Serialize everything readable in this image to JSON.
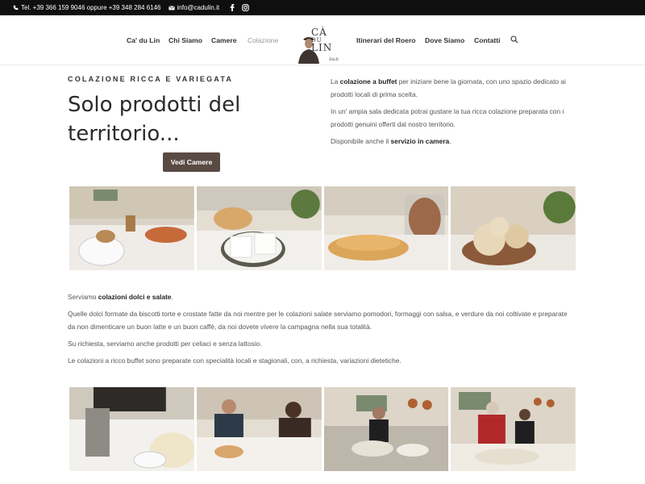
{
  "topbar": {
    "phone": "Tel. +39 366 159 9046 oppure +39 348 284 6146",
    "email": "info@cadulin.it",
    "icons": [
      "phone-icon",
      "mail-icon",
      "facebook-icon",
      "instagram-icon"
    ]
  },
  "nav": {
    "items": [
      "Ca' du Lin",
      "Chi Siamo",
      "Camere",
      "Colazione",
      "Itinerari del Roero",
      "Dove Siamo",
      "Contatti"
    ],
    "active": "Colazione"
  },
  "logo": {
    "line1": "CÀ",
    "line2": "DU",
    "line3": "LIN",
    "sub": "B&B"
  },
  "hero": {
    "eyebrow": "COLAZIONE RICCA E VARIEGATA",
    "title": "Solo prodotti del territorio...",
    "button": "Vedi Camere"
  },
  "intro": {
    "p1_pre": "La ",
    "p1_bold": "colazione a buffet",
    "p1_post": " per iniziare bene la giornata, con uno spazio dedicato ai prodotti locali di prima scelta.",
    "p2": "In un' ampia sala dedicata potrai gustare la tua ricca colazione preparata con i prodotti genuini offerti dal nostro territorio.",
    "p3_pre": "Disponibile anche il ",
    "p3_bold": "servizio in camera",
    "p3_post": "."
  },
  "body": {
    "p1_pre": "Serviamo ",
    "p1_bold": "colazioni dolci e salate",
    "p1_post": ".",
    "p2": "Quelle dolci formate da biscotti torte e crostate fatte da noi mentre per le colazioni salate serviamo pomodori, formaggi con salsa, e verdure da noi coltivate e preparate da non dimenticare un buon latte e un buon caffè, da noi dovete vivere la campagna nella sua totalità.",
    "p3": "Su richiesta, serviamo anche prodotti per celiaci e senza lattosio.",
    "p4": "Le colazioni a ricco buffet sono preparate con specialità locali e stagionali, con, a richiesta, variazioni dietetiche."
  },
  "colors": {
    "topbar": "#0f0f0f",
    "button": "#5a4a44",
    "heading": "#2b2b2b"
  }
}
